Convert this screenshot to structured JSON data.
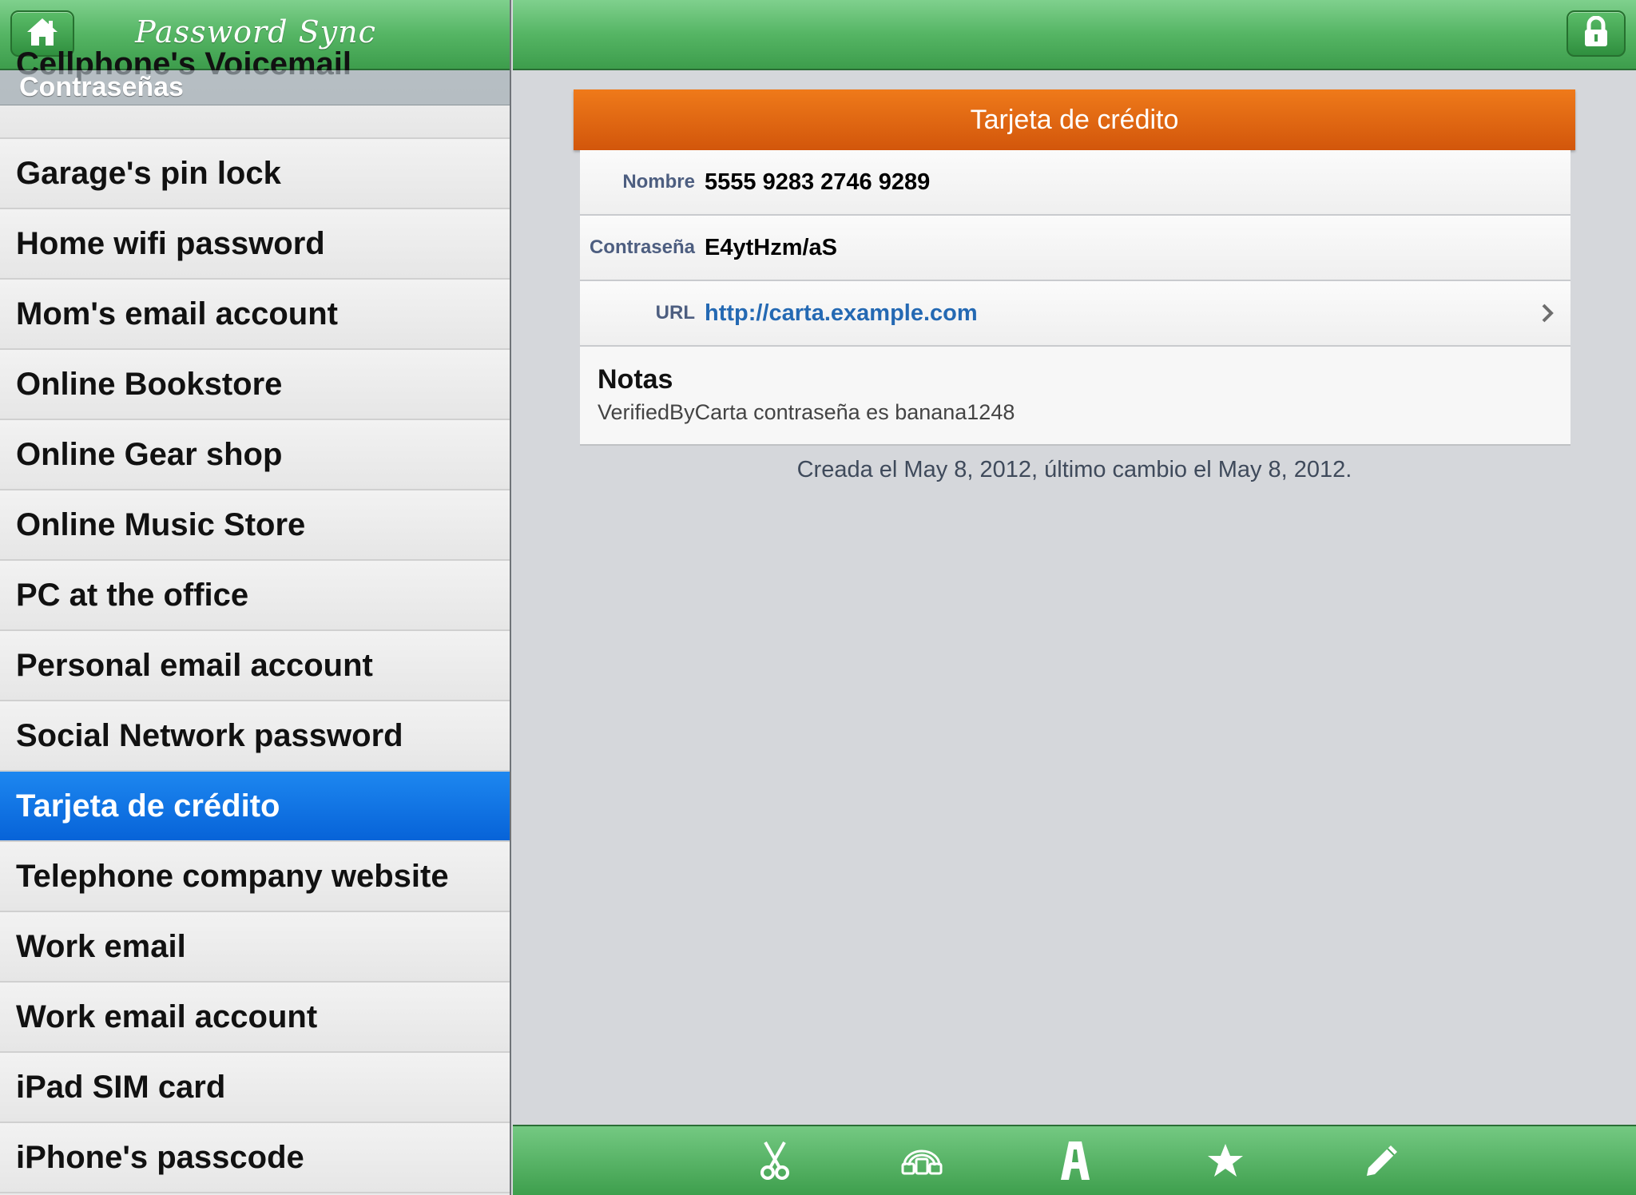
{
  "app": {
    "title": "Password Sync"
  },
  "sidebar": {
    "section_header": "Contraseñas",
    "partial_item": "Cellphone's Voicemail",
    "items": [
      "Garage's pin lock",
      "Home wifi password",
      "Mom's email account",
      "Online Bookstore",
      "Online Gear shop",
      "Online Music Store",
      "PC at the office",
      "Personal email account",
      "Social Network password",
      "Tarjeta de crédito",
      "Telephone company website",
      "Work email",
      "Work email account",
      "iPad SIM card",
      "iPhone's passcode"
    ],
    "selected_index": 9
  },
  "detail": {
    "header": "Tarjeta de crédito",
    "fields": {
      "nombre_label": "Nombre",
      "nombre_value": "5555 9283 2746 9289",
      "password_label": "Contraseña",
      "password_value": "E4ytHzm/aS",
      "url_label": "URL",
      "url_value": "http://carta.example.com"
    },
    "notes": {
      "title": "Notas",
      "text": "VerifiedByCarta contraseña es banana1248"
    },
    "footer": "Creada el May 8, 2012, último cambio el May 8, 2012."
  },
  "icons": {
    "home": "home-icon",
    "lock": "lock-icon",
    "toolbar": [
      "scissors-icon",
      "sync-icon",
      "font-icon",
      "star-icon",
      "pencil-icon"
    ]
  },
  "colors": {
    "nav_green": "#55b564",
    "header_orange": "#e06a12",
    "selected_blue": "#0a6fe0",
    "label_blue": "#4d5e80",
    "link_blue": "#2469b3"
  }
}
